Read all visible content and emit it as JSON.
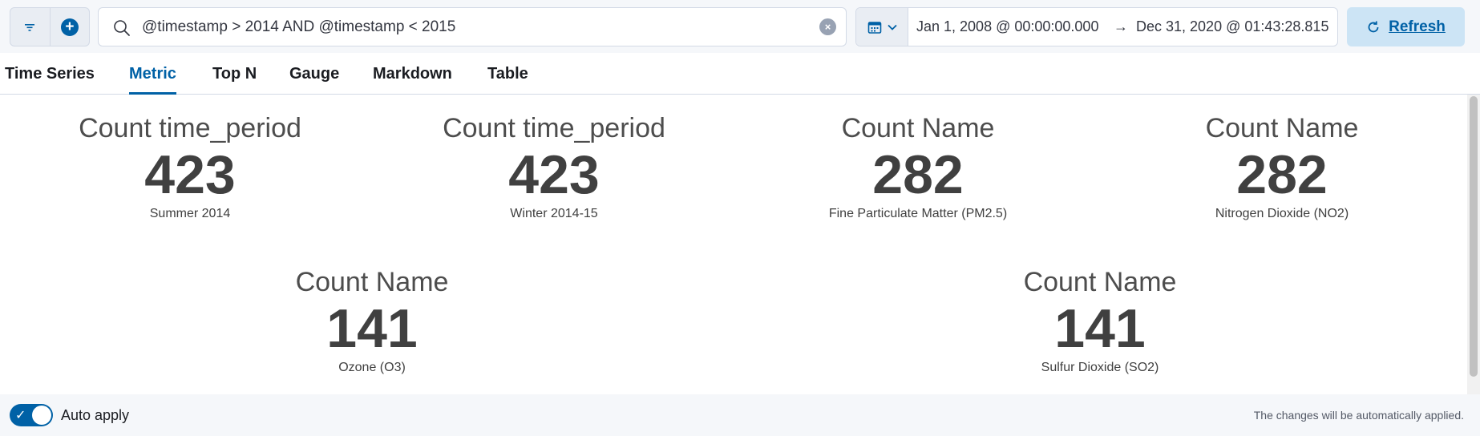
{
  "query_bar": {
    "query": "@timestamp > 2014 AND @timestamp < 2015",
    "start_date": "Jan 1, 2008 @ 00:00:00.000",
    "arrow": "→",
    "end_date": "Dec 31, 2020 @ 01:43:28.815",
    "refresh_label": "Refresh"
  },
  "tabs": [
    {
      "label": "Time Series"
    },
    {
      "label": "Metric",
      "active": true
    },
    {
      "label": "Top N"
    },
    {
      "label": "Gauge"
    },
    {
      "label": "Markdown"
    },
    {
      "label": "Table"
    }
  ],
  "metrics": [
    {
      "title": "Count time_period",
      "value": "423",
      "label": "Summer 2014"
    },
    {
      "title": "Count time_period",
      "value": "423",
      "label": "Winter 2014-15"
    },
    {
      "title": "Count Name",
      "value": "282",
      "label": "Fine Particulate Matter (PM2.5)"
    },
    {
      "title": "Count Name",
      "value": "282",
      "label": "Nitrogen Dioxide (NO2)"
    },
    {
      "title": "Count Name",
      "value": "141",
      "label": "Ozone (O3)"
    },
    {
      "title": "Count Name",
      "value": "141",
      "label": "Sulfur Dioxide (SO2)"
    }
  ],
  "bottom_bar": {
    "auto_apply_label": "Auto apply",
    "auto_apply_on": true,
    "hint": "The changes will be automatically applied."
  },
  "colors": {
    "accent": "#0061a6",
    "metric_text": "#404040",
    "bar_background": "#f5f7fa"
  }
}
